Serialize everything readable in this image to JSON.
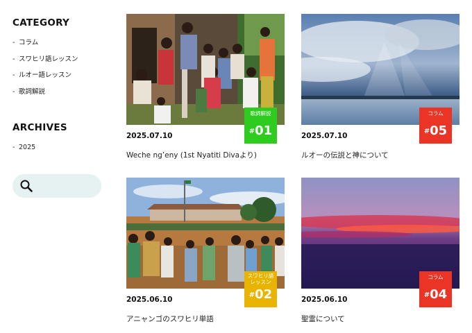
{
  "sidebar": {
    "category_heading": "CATEGORY",
    "categories": [
      {
        "label": "コラム"
      },
      {
        "label": "スワヒリ語レッスン"
      },
      {
        "label": "ルオー語レッスン"
      },
      {
        "label": "歌詞解説"
      }
    ],
    "archives_heading": "ARCHIVES",
    "archives": [
      {
        "label": "2025"
      }
    ],
    "list_marker": "-",
    "search_icon": "search-icon"
  },
  "posts": [
    {
      "number": "01",
      "number_prefix": "#",
      "category": "歌詞解説",
      "badge_color": "#2ecc1e",
      "date": "2025.07.10",
      "title": "Weche ng’eny (1st Nyatiti Divaより)",
      "image": "group-of-children-photo"
    },
    {
      "number": "05",
      "number_prefix": "#",
      "category": "コラム",
      "badge_color": "#ea3426",
      "date": "2025.07.10",
      "title": "ルオーの伝説と神について",
      "image": "lake-sky-sunrays-photo"
    },
    {
      "number": "02",
      "number_prefix": "#",
      "category": "スワヒリ語 レッスン",
      "badge_color": "#e9b400",
      "date": "2025.06.10",
      "title": "アニャンゴのスワヒリ単語",
      "image": "school-children-photo"
    },
    {
      "number": "04",
      "number_prefix": "#",
      "category": "コラム",
      "badge_color": "#ea3426",
      "date": "2025.06.10",
      "title": "聖霊について",
      "image": "sunset-horizon-photo"
    }
  ]
}
